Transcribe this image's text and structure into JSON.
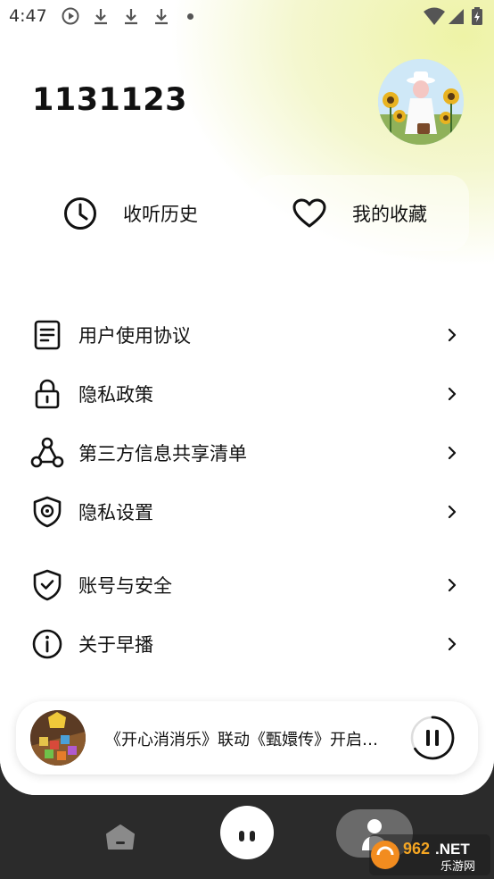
{
  "status_bar": {
    "time": "4:47"
  },
  "profile": {
    "username": "1131123"
  },
  "quick_actions": [
    {
      "label": "收听历史",
      "icon": "clock-icon"
    },
    {
      "label": "我的收藏",
      "icon": "heart-icon"
    }
  ],
  "menu": {
    "items": [
      {
        "label": "用户使用协议",
        "icon": "document-icon"
      },
      {
        "label": "隐私政策",
        "icon": "lock-icon"
      },
      {
        "label": "第三方信息共享清单",
        "icon": "share-network-icon"
      },
      {
        "label": "隐私设置",
        "icon": "shield-settings-icon"
      },
      {
        "label": "账号与安全",
        "icon": "shield-check-icon"
      },
      {
        "label": "关于早播",
        "icon": "info-icon"
      }
    ]
  },
  "player": {
    "title": "《开心消消乐》联动《甄嬛传》开启…",
    "state": "playing"
  },
  "watermark": {
    "brand": "962.NET",
    "sub": "乐游网"
  },
  "colors": {
    "accent_gradient": "#eef3a6",
    "nav_bg": "#2b2b2b"
  }
}
